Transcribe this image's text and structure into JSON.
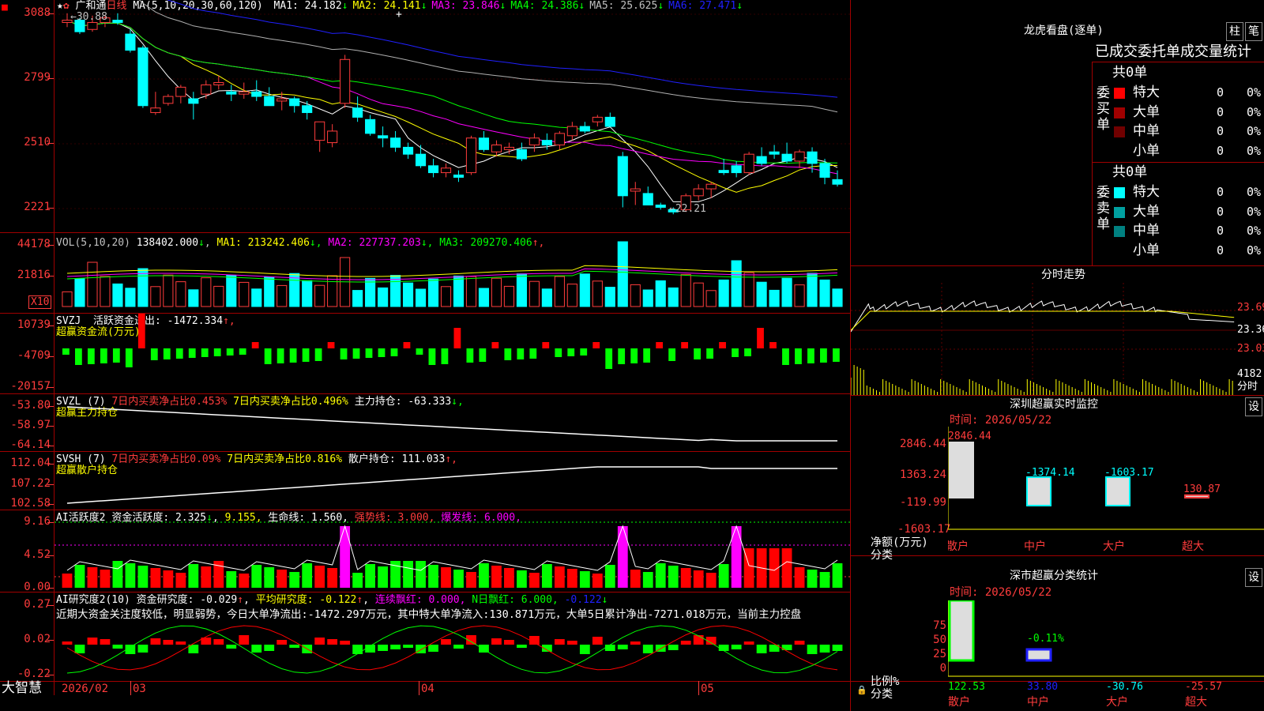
{
  "app_name": "大智慧",
  "stock": {
    "name": "广和通",
    "period": "日线"
  },
  "main": {
    "indicator": "MA(5,10,20,30,60,120)",
    "ma": [
      {
        "label": "MA1: 24.182",
        "arrow": "↓",
        "color": "#ffffff"
      },
      {
        "label": "MA2: 24.141",
        "arrow": "↓",
        "color": "#ffff00"
      },
      {
        "label": "MA3: 23.846",
        "arrow": "↓",
        "color": "#ff00ff"
      },
      {
        "label": "MA4: 24.386",
        "arrow": "↓",
        "color": "#00ff00"
      },
      {
        "label": "MA5: 25.625",
        "arrow": "↓",
        "color": "#c0c0c0"
      },
      {
        "label": "MA6: 27.471",
        "arrow": "↓",
        "color": "#2020ff"
      }
    ],
    "yticks": [
      "3088",
      "2799",
      "2510",
      "2221"
    ],
    "high_label": "30.88",
    "low_label": "22.21"
  },
  "vol": {
    "title": "VOL(5,10,20)",
    "value": "138402.000",
    "ma": [
      {
        "label": "MA1: 213242.406",
        "arrow": "↓",
        "color": "#ffff00"
      },
      {
        "label": "MA2: 227737.203",
        "arrow": "↓",
        "color": "#ff00ff"
      },
      {
        "label": "MA3: 209270.406",
        "arrow": "↑",
        "color": "#00ff00"
      }
    ],
    "yticks": [
      "44178",
      "21816"
    ],
    "unit": "X10"
  },
  "svzj": {
    "title": "SVZJ",
    "label": "活跃资金进出: -1472.334",
    "arrow": "↑,",
    "sub": "超赢资金流(万元)",
    "yticks": [
      "10739",
      "-4709",
      "-20157"
    ]
  },
  "svzl": {
    "title": "SVZL (7)",
    "a": "7日内买卖净占比0.453%",
    "b": "7日内买卖净占比0.496%",
    "c": "主力持仓: -63.333",
    "arrow": "↓,",
    "sub": "超赢主力持仓",
    "yticks": [
      "-53.80",
      "-58.97",
      "-64.14"
    ]
  },
  "svsh": {
    "title": "SVSH (7)",
    "a": "7日内买卖净占比0.09%",
    "b": "7日内买卖净占比0.816%",
    "c": "散户持仓: 111.033",
    "arrow": "↑,",
    "sub": "超赢散户持仓",
    "yticks": [
      "112.04",
      "107.22",
      "102.58"
    ]
  },
  "ai1": {
    "title": "AI活跃度2",
    "a": "资金活跃度: 2.325",
    "b": "9.155,",
    "c": "生命线: 1.560,",
    "d": "强势线: 3.000,",
    "e": "爆发线: 6.000,",
    "yticks": [
      "9.16",
      "4.52",
      "0.00"
    ]
  },
  "ai2": {
    "title": "AI研究度2(10)",
    "a": "资金研究度: -0.029",
    "b": "平均研究度: -0.122",
    "c": "连续飘红: 0.000,",
    "d": "N日飘红: 6.000,",
    "e": "-0.122",
    "yticks": [
      "0.27",
      "0.02",
      "-0.22"
    ],
    "commentary": "近期大资金关注度较低，明显弱势，今日大单净流出:-1472.297万元，其中特大单净流入:130.871万元，大单5日累计净出-7271.018万元，当前主力控盘"
  },
  "xaxis": {
    "start": "2026/02",
    "labels": [
      "03",
      "04",
      "05"
    ]
  },
  "longhu": {
    "title": "龙虎看盘(逐单)",
    "btn1": "柱",
    "btn2": "笔",
    "header": "已成交委托单成交量统计",
    "buy": {
      "side": "委买单",
      "total": "共0单",
      "rows": [
        {
          "name": "特大",
          "n": "0",
          "p": "0%",
          "color": "#ff0000"
        },
        {
          "name": "大单",
          "n": "0",
          "p": "0%",
          "color": "#a00000"
        },
        {
          "name": "中单",
          "n": "0",
          "p": "0%",
          "color": "#700000"
        },
        {
          "name": "小单",
          "n": "0",
          "p": "0%",
          "color": "#000000"
        }
      ]
    },
    "sell": {
      "side": "委卖单",
      "total": "共0单",
      "rows": [
        {
          "name": "特大",
          "n": "0",
          "p": "0%",
          "color": "#00ffff"
        },
        {
          "name": "大单",
          "n": "0",
          "p": "0%",
          "color": "#00a0a0"
        },
        {
          "name": "中单",
          "n": "0",
          "p": "0%",
          "color": "#008080"
        },
        {
          "name": "小单",
          "n": "0",
          "p": "0%",
          "color": "#000000"
        }
      ]
    }
  },
  "fenshi": {
    "title": "分时走势",
    "yticks": [
      "23.69",
      "23.36",
      "23.03"
    ],
    "vol": "4182",
    "vol_unit": "分时"
  },
  "szss": {
    "title": "深圳超赢实时监控",
    "btn": "设",
    "time": "时间: 2026/05/22",
    "yticks": [
      "2846.44",
      "1363.24",
      "-119.99",
      "-1603.17"
    ],
    "ylabel": "净额(万元)",
    "xlabel": "分类",
    "bars": [
      {
        "cat": "散户",
        "val": "2846.44"
      },
      {
        "cat": "中户",
        "val": "-1374.14"
      },
      {
        "cat": "大户",
        "val": "-1603.17"
      },
      {
        "cat": "超大",
        "val": "130.87"
      }
    ]
  },
  "szfl": {
    "title": "深市超赢分类统计",
    "btn": "设",
    "time": "时间: 2026/05/22",
    "yticks": [
      "75",
      "50",
      "25",
      "0"
    ],
    "ylabel": "比例%",
    "xlabel": "分类",
    "top_label": "-0.11%",
    "bars": [
      {
        "cat": "散户",
        "val": "122.53"
      },
      {
        "cat": "中户",
        "val": "33.80"
      },
      {
        "cat": "大户",
        "val": "-30.76"
      },
      {
        "cat": "超大",
        "val": "-25.57"
      }
    ]
  },
  "chart_data": {
    "type": "candlestick",
    "title": "广和通 日线",
    "ylim": [
      22.21,
      30.88
    ],
    "ohlc": [
      [
        30.5,
        30.9,
        30.3,
        30.6
      ],
      [
        30.6,
        30.7,
        30.0,
        30.1
      ],
      [
        30.2,
        30.8,
        30.1,
        30.5
      ],
      [
        30.5,
        30.8,
        30.3,
        30.7
      ],
      [
        30.6,
        30.9,
        30.4,
        30.5
      ],
      [
        30.0,
        30.2,
        29.2,
        29.3
      ],
      [
        29.4,
        29.5,
        26.8,
        26.9
      ],
      [
        26.6,
        27.5,
        26.5,
        26.8
      ],
      [
        27.0,
        27.4,
        26.9,
        27.3
      ],
      [
        27.3,
        27.8,
        27.0,
        27.7
      ],
      [
        27.2,
        27.5,
        26.3,
        27.0
      ],
      [
        27.4,
        28.0,
        27.2,
        27.8
      ],
      [
        27.8,
        28.2,
        27.6,
        27.9
      ],
      [
        27.5,
        27.8,
        27.1,
        27.4
      ],
      [
        27.4,
        27.9,
        27.2,
        27.5
      ],
      [
        27.5,
        28.0,
        27.1,
        27.3
      ],
      [
        27.3,
        27.7,
        26.9,
        26.9
      ],
      [
        27.1,
        27.5,
        26.7,
        27.2
      ],
      [
        27.2,
        27.3,
        26.6,
        26.9
      ],
      [
        26.9,
        27.1,
        26.3,
        26.6
      ],
      [
        25.4,
        26.2,
        24.9,
        26.2
      ],
      [
        25.3,
        26.1,
        25.1,
        25.8
      ],
      [
        27.0,
        29.1,
        26.8,
        28.9
      ],
      [
        26.8,
        27.3,
        26.2,
        26.4
      ],
      [
        26.3,
        26.5,
        25.6,
        25.7
      ],
      [
        25.6,
        26.0,
        25.1,
        25.5
      ],
      [
        25.5,
        25.8,
        24.9,
        25.1
      ],
      [
        25.1,
        25.3,
        24.6,
        24.8
      ],
      [
        24.8,
        25.2,
        24.2,
        24.3
      ],
      [
        24.3,
        24.6,
        23.8,
        24.0
      ],
      [
        24.0,
        24.4,
        23.8,
        24.2
      ],
      [
        23.9,
        24.1,
        23.6,
        23.8
      ],
      [
        24.0,
        25.6,
        23.9,
        25.5
      ],
      [
        25.5,
        25.8,
        24.9,
        25.0
      ],
      [
        24.9,
        25.4,
        24.7,
        25.2
      ],
      [
        25.0,
        25.3,
        24.8,
        25.1
      ],
      [
        25.0,
        25.3,
        24.5,
        24.6
      ],
      [
        25.2,
        25.7,
        24.9,
        25.5
      ],
      [
        25.4,
        25.7,
        25.0,
        25.2
      ],
      [
        25.2,
        25.8,
        25.0,
        25.7
      ],
      [
        25.6,
        26.2,
        25.4,
        26.0
      ],
      [
        26.0,
        26.2,
        25.7,
        25.8
      ],
      [
        26.2,
        26.5,
        26.0,
        26.4
      ],
      [
        26.4,
        26.6,
        26.0,
        26.0
      ],
      [
        24.7,
        24.9,
        22.5,
        23.0
      ],
      [
        23.2,
        23.6,
        22.6,
        23.3
      ],
      [
        23.1,
        23.4,
        22.6,
        22.6
      ],
      [
        22.6,
        22.7,
        22.4,
        22.5
      ],
      [
        22.4,
        22.5,
        22.2,
        22.3
      ],
      [
        22.4,
        23.1,
        22.3,
        23.0
      ],
      [
        23.0,
        23.5,
        22.8,
        23.3
      ],
      [
        23.3,
        23.6,
        22.9,
        23.5
      ],
      [
        24.1,
        24.6,
        23.9,
        24.0
      ],
      [
        24.3,
        24.5,
        23.8,
        24.0
      ],
      [
        24.0,
        24.9,
        23.9,
        24.8
      ],
      [
        24.7,
        25.1,
        24.3,
        24.4
      ],
      [
        24.9,
        25.2,
        24.6,
        24.8
      ],
      [
        24.8,
        25.3,
        24.4,
        24.5
      ],
      [
        24.5,
        25.0,
        24.2,
        24.9
      ],
      [
        24.9,
        25.1,
        24.0,
        24.4
      ],
      [
        24.4,
        24.6,
        23.5,
        23.8
      ],
      [
        23.7,
        24.1,
        23.4,
        23.5
      ]
    ]
  }
}
